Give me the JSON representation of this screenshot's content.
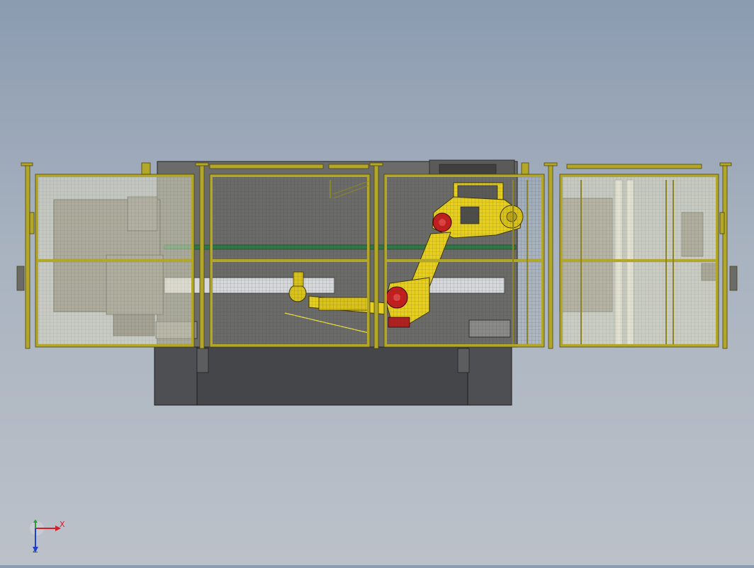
{
  "viewport": {
    "background_top": "#8b9bb0",
    "background_bottom": "#bcc1c9"
  },
  "model": {
    "fence_color": "#b3a72a",
    "fence_outline": "#4a4410",
    "machine_base_color": "#4e4f52",
    "machine_body_color": "#6b6c6a",
    "robot_color": "#e6cf1e",
    "robot_joint_color": "#c41e1e",
    "mesh_color": "#c9c98c"
  },
  "triad": {
    "x_label": "X",
    "y_label": "Y",
    "z_label": "Z",
    "x_color": "#d4202a",
    "y_color": "#2a9d3a",
    "z_color": "#1f3fd1",
    "icon": "coordinate-axes-icon"
  }
}
